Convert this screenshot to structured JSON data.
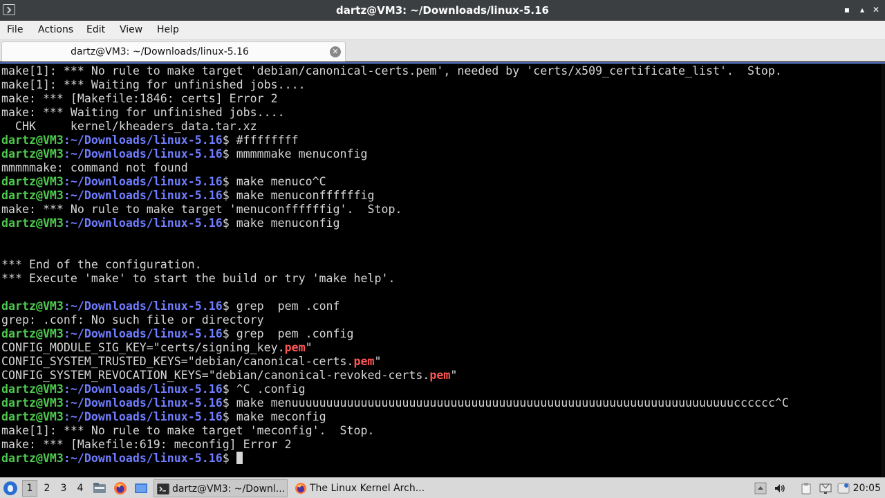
{
  "window": {
    "title": "dartz@VM3: ~/Downloads/linux-5.16",
    "minimize": "▪",
    "maximize": "▴",
    "close": "✕"
  },
  "menu": {
    "file": "File",
    "actions": "Actions",
    "edit": "Edit",
    "view": "View",
    "help": "Help"
  },
  "tab": {
    "label": "dartz@VM3: ~/Downloads/linux-5.16",
    "close": "✕"
  },
  "terminal": {
    "prompt_user": "dartz@VM3",
    "prompt_path": ":~/Downloads/linux-5.16",
    "prompt_suffix": "$ ",
    "lines": [
      {
        "text": "make[1]: *** No rule to make target 'debian/canonical-certs.pem', needed by 'certs/x509_certificate_list'.  Stop."
      },
      {
        "text": "make[1]: *** Waiting for unfinished jobs...."
      },
      {
        "text": "make: *** [Makefile:1846: certs] Error 2"
      },
      {
        "text": "make: *** Waiting for unfinished jobs...."
      },
      {
        "text": "  CHK     kernel/kheaders_data.tar.xz"
      },
      {
        "prompt": true,
        "cmd": "#ffffffff"
      },
      {
        "prompt": true,
        "cmd": "mmmmmake menuconfig"
      },
      {
        "text": "mmmmmake: command not found"
      },
      {
        "prompt": true,
        "cmd": "make menuco^C"
      },
      {
        "prompt": true,
        "cmd": "make menuconffffffig"
      },
      {
        "text": "make: *** No rule to make target 'menuconffffffig'.  Stop."
      },
      {
        "prompt": true,
        "cmd": "make menuconfig"
      },
      {
        "text": ""
      },
      {
        "text": ""
      },
      {
        "text": "*** End of the configuration."
      },
      {
        "text": "*** Execute 'make' to start the build or try 'make help'."
      },
      {
        "text": ""
      },
      {
        "prompt": true,
        "cmd": "grep  pem .conf"
      },
      {
        "text": "grep: .conf: No such file or directory"
      },
      {
        "prompt": true,
        "cmd": "grep  pem .config"
      },
      {
        "text": "CONFIG_MODULE_SIG_KEY=\"certs/signing_key.",
        "hl": "pem",
        "after": "\""
      },
      {
        "text": "CONFIG_SYSTEM_TRUSTED_KEYS=\"debian/canonical-certs.",
        "hl": "pem",
        "after": "\""
      },
      {
        "text": "CONFIG_SYSTEM_REVOCATION_KEYS=\"debian/canonical-revoked-certs.",
        "hl": "pem",
        "after": "\""
      },
      {
        "prompt": true,
        "cmd": "^C .config"
      },
      {
        "prompt": true,
        "cmd": "make menuuuuuuuuuuuuuuuuuuuuuuuuuuuuuuuuuuuuuuuuuuuuuuuuuuuuuuuuuuuuuuuucccccc^C"
      },
      {
        "prompt": true,
        "cmd": "make meconfig"
      },
      {
        "text": "make[1]: *** No rule to make target 'meconfig'.  Stop."
      },
      {
        "text": "make: *** [Makefile:619: meconfig] Error 2"
      },
      {
        "prompt": true,
        "cmd": "",
        "cursor": true
      }
    ]
  },
  "taskbar": {
    "workspaces": [
      "1",
      "2",
      "3",
      "4"
    ],
    "tasks": [
      {
        "label": "dartz@VM3: ~/Downl...",
        "icon": "terminal-icon"
      },
      {
        "label": "The Linux Kernel Arch...",
        "icon": "firefox-icon"
      }
    ],
    "clock": "20:05"
  },
  "colors": {
    "prompt_user": "#4ec94e",
    "prompt_path": "#6f7dff",
    "highlight": "#ff5555",
    "terminal_bg": "#000000",
    "terminal_fg": "#d6d6d6"
  }
}
